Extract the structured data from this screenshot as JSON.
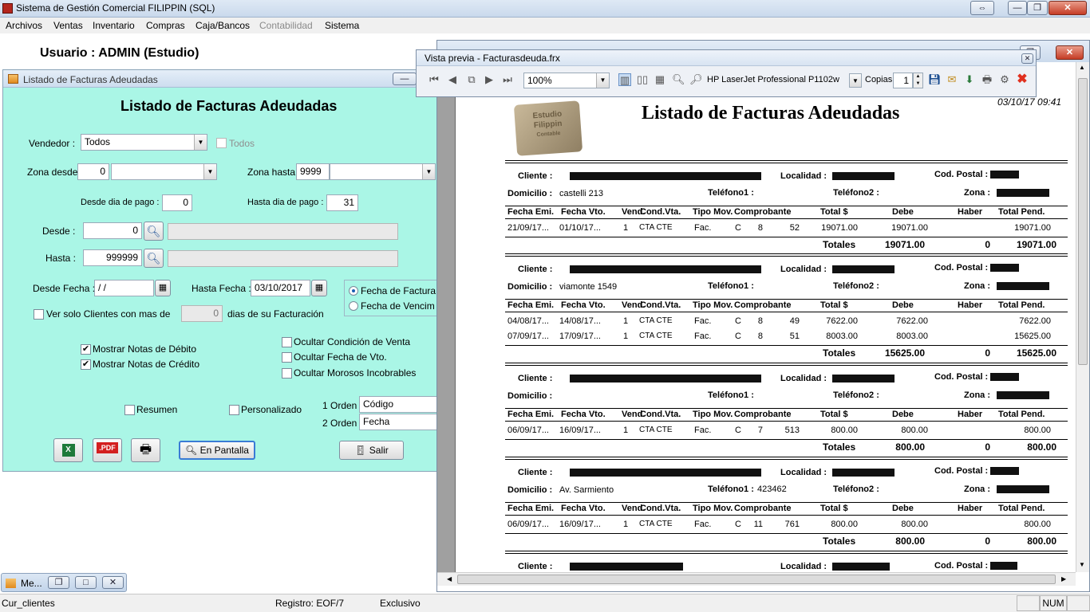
{
  "app": {
    "title": "Sistema de Gestión Comercial FILIPPIN (SQL)",
    "menus": [
      "Archivos",
      "Ventas",
      "Inventario",
      "Compras",
      "Caja/Bancos",
      "Contabilidad",
      "Sistema"
    ],
    "user_label": "Usuario : ADMIN  (Estudio)"
  },
  "form": {
    "window_title": "Listado de Facturas Adeudadas",
    "heading": "Listado de Facturas Adeudadas",
    "vendedor_label": "Vendedor :",
    "vendedor_value": "Todos",
    "todos_label": "Todos",
    "zona_desde_label": "Zona desde:",
    "zona_desde_value": "0",
    "zona_hasta_label": "Zona hasta:",
    "zona_hasta_value": "9999",
    "desde_dia_label": "Desde dia de pago :",
    "desde_dia_value": "0",
    "hasta_dia_label": "Hasta dia de pago :",
    "hasta_dia_value": "31",
    "desde_label": "Desde :",
    "desde_value": "0",
    "hasta_label": "Hasta :",
    "hasta_value": "999999",
    "desde_fecha_label": "Desde Fecha :",
    "desde_fecha_value": " / /",
    "hasta_fecha_label": "Hasta Fecha :",
    "hasta_fecha_value": "03/10/2017",
    "radio_fecha_factura": "Fecha de Factura",
    "radio_fecha_venc": "Fecha de Vencim",
    "ver_solo_label": "Ver solo Clientes con mas de",
    "ver_solo_value": "0",
    "dias_label": "dias de su Facturación",
    "mostrar_debito": "Mostrar Notas de Débito",
    "mostrar_credito": "Mostrar Notas de Crédito",
    "ocultar_condicion": "Ocultar Condición de Venta",
    "ocultar_fecha": "Ocultar Fecha de Vto.",
    "ocultar_morosos": "Ocultar Morosos Incobrables",
    "resumen": "Resumen",
    "personalizado": "Personalizado",
    "orden1_label": "1 Orden :",
    "orden1_value": "Código",
    "orden2_label": "2 Orden :",
    "orden2_value": "Fecha",
    "pdf_label": ".PDF",
    "en_pantalla": "En Pantalla",
    "salir": "Salir"
  },
  "minimized": {
    "label": "Me..."
  },
  "preview": {
    "window_title": "Vista previa - Facturasdeuda.frx",
    "zoom": "100%",
    "printer": "HP LaserJet Professional P1102w",
    "copias_label": "Copias",
    "copias_value": "1",
    "report_title": "Listado de Facturas Adeudadas",
    "report_date": "03/10/17 09:41",
    "logo_text": [
      "Estudio",
      "Filippin",
      "Contable"
    ],
    "labels": {
      "cliente": "Cliente :",
      "localidad": "Localidad :",
      "cod_postal": "Cod. Postal :",
      "domicilio": "Domicilio :",
      "telefono1": "Teléfono1 :",
      "telefono2": "Teléfono2 :",
      "zona": "Zona :",
      "totales": "Totales"
    },
    "columns": [
      "Fecha Emi.",
      "Fecha Vto.",
      "Vend.",
      "Cond.Vta.",
      "Tipo Mov.",
      "Comprobante",
      "Total $",
      "Debe",
      "Haber",
      "Total Pend."
    ],
    "clients": [
      {
        "domicilio": "castelli 213",
        "telefono1": "",
        "rows": [
          {
            "fecha_emi": "21/09/17...",
            "fecha_vto": "01/10/17...",
            "vend": "1",
            "cond": "CTA CTE",
            "tipo": "Fac.",
            "letra": "C",
            "pv": "8",
            "num": "52",
            "total": "19071.00",
            "debe": "19071.00",
            "haber": "",
            "pend": "19071.00"
          }
        ],
        "tot_debe": "19071.00",
        "tot_haber": "0",
        "tot_pend": "19071.00"
      },
      {
        "domicilio": "viamonte 1549",
        "telefono1": "",
        "rows": [
          {
            "fecha_emi": "04/08/17...",
            "fecha_vto": "14/08/17...",
            "vend": "1",
            "cond": "CTA CTE",
            "tipo": "Fac.",
            "letra": "C",
            "pv": "8",
            "num": "49",
            "total": "7622.00",
            "debe": "7622.00",
            "haber": "",
            "pend": "7622.00"
          },
          {
            "fecha_emi": "07/09/17...",
            "fecha_vto": "17/09/17...",
            "vend": "1",
            "cond": "CTA CTE",
            "tipo": "Fac.",
            "letra": "C",
            "pv": "8",
            "num": "51",
            "total": "8003.00",
            "debe": "8003.00",
            "haber": "",
            "pend": "15625.00"
          }
        ],
        "tot_debe": "15625.00",
        "tot_haber": "0",
        "tot_pend": "15625.00"
      },
      {
        "domicilio": "",
        "telefono1": "",
        "rows": [
          {
            "fecha_emi": "06/09/17...",
            "fecha_vto": "16/09/17...",
            "vend": "1",
            "cond": "CTA CTE",
            "tipo": "Fac.",
            "letra": "C",
            "pv": "7",
            "num": "513",
            "total": "800.00",
            "debe": "800.00",
            "haber": "",
            "pend": "800.00"
          }
        ],
        "tot_debe": "800.00",
        "tot_haber": "0",
        "tot_pend": "800.00"
      },
      {
        "domicilio": "Av. Sarmiento",
        "telefono1": "423462",
        "rows": [
          {
            "fecha_emi": "06/09/17...",
            "fecha_vto": "16/09/17...",
            "vend": "1",
            "cond": "CTA CTE",
            "tipo": "Fac.",
            "letra": "C",
            "pv": "11",
            "num": "761",
            "total": "800.00",
            "debe": "800.00",
            "haber": "",
            "pend": "800.00"
          }
        ],
        "tot_debe": "800.00",
        "tot_haber": "0",
        "tot_pend": "800.00"
      }
    ]
  },
  "status": {
    "cursor": "Cur_clientes",
    "registro": "Registro: EOF/7",
    "exclusivo": "Exclusivo",
    "num": "NUM"
  }
}
